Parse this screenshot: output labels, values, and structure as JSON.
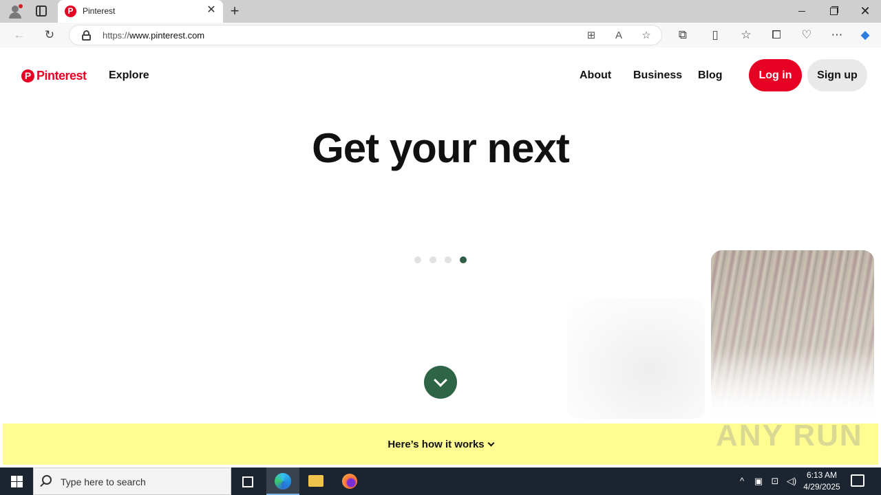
{
  "browser": {
    "tab_title": "Pinterest",
    "tab_close": "✕",
    "new_tab": "+",
    "url_prefix": "https://",
    "url_host": "www.pinterest.com",
    "close_glyph": "✕"
  },
  "header": {
    "logo_mark": "P",
    "logo_text": "Pinterest",
    "explore": "Explore",
    "about": "About",
    "business": "Business",
    "blog": "Blog",
    "login": "Log in",
    "signup": "Sign up"
  },
  "hero": {
    "headline": "Get your next",
    "carousel_dots": 4,
    "active_dot": 4
  },
  "how_it_works": {
    "label": "Here’s how it works"
  },
  "watermark": "ANY RUN",
  "taskbar": {
    "search_placeholder": "Type here to search",
    "time": "6:13 AM",
    "date": "4/29/2025"
  },
  "colors": {
    "brand_red": "#e60023",
    "accent_green": "#2f6547",
    "banner_yellow": "#fffd92"
  }
}
